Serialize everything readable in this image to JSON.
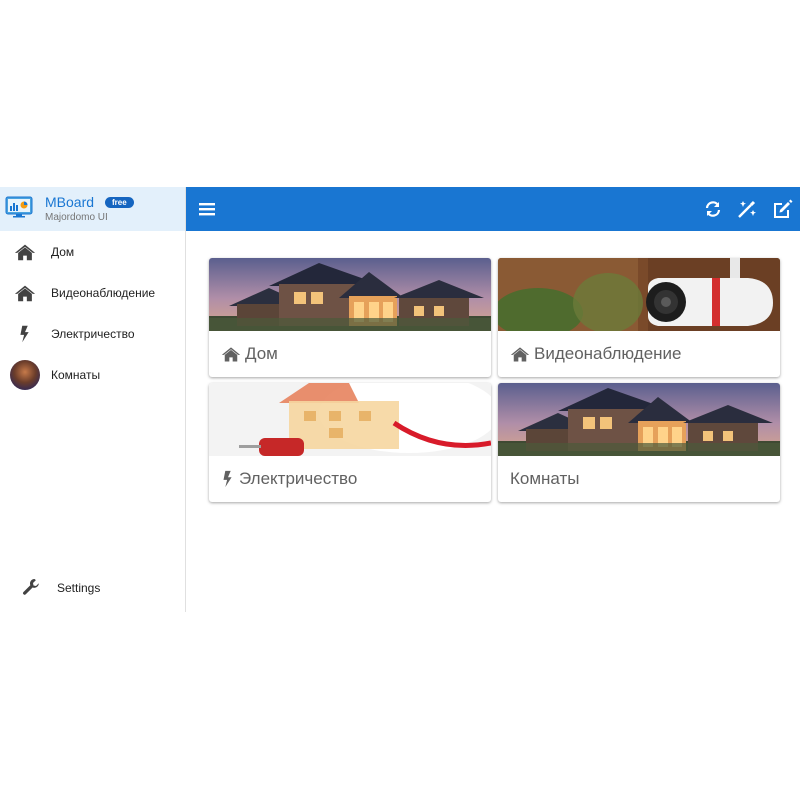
{
  "brand": {
    "name": "MBoard",
    "badge": "free",
    "subtitle": "Majordomo UI"
  },
  "sidebar": {
    "items": [
      {
        "label": "Дом",
        "icon": "home-icon"
      },
      {
        "label": "Видеонаблюдение",
        "icon": "home-icon"
      },
      {
        "label": "Электричество",
        "icon": "bolt-icon"
      },
      {
        "label": "Комнаты",
        "icon": "avatar"
      }
    ],
    "settings_label": "Settings"
  },
  "toolbar": {
    "menu_icon": "hamburger-icon",
    "actions": [
      "refresh-icon",
      "magic-icon",
      "edit-icon"
    ]
  },
  "cards": [
    {
      "title": "Дом",
      "icon": "home-icon",
      "image": "house-photo"
    },
    {
      "title": "Видеонаблюдение",
      "icon": "home-icon",
      "image": "camera-photo"
    },
    {
      "title": "Электричество",
      "icon": "bolt-icon",
      "image": "plug-photo"
    },
    {
      "title": "Комнаты",
      "icon": "",
      "image": "house-photo"
    }
  ],
  "colors": {
    "primary": "#1976d2",
    "brand_bg": "#e3f0fb",
    "badge": "#1565c0"
  }
}
